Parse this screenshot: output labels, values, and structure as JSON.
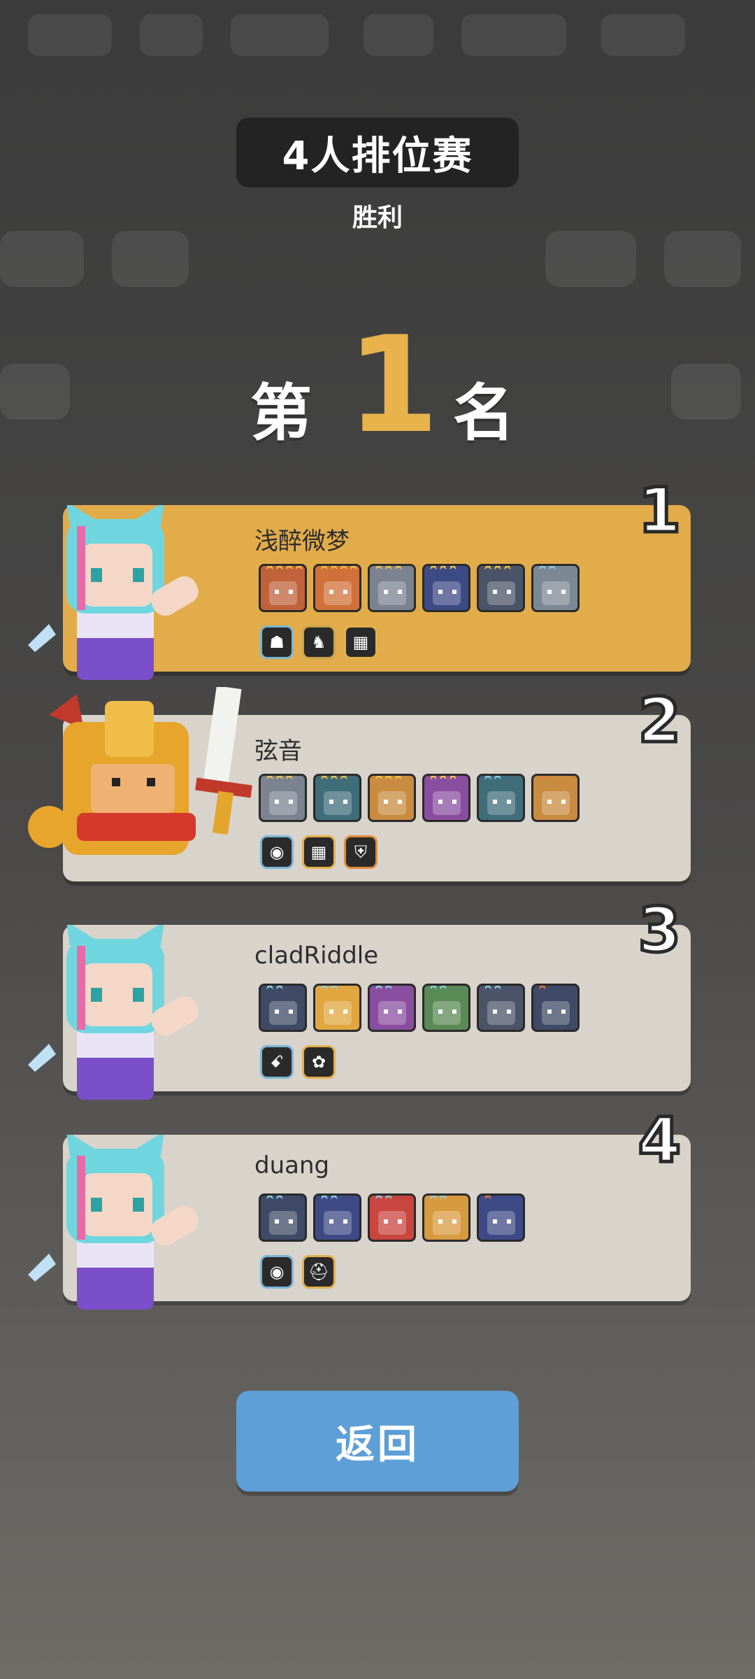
{
  "header": {
    "mode": "4人排位赛",
    "result": "胜利"
  },
  "rank": {
    "prefix": "第",
    "number": "1",
    "suffix": "名"
  },
  "players": [
    {
      "place": "1",
      "name": "浅醉微梦",
      "highlight": true,
      "avatar": "cat-girl-icon",
      "heroes": [
        {
          "color": "#c0623a",
          "stars": 4,
          "star_color": "#f3c64b"
        },
        {
          "color": "#d0703a",
          "stars": 4,
          "star_color": "#f3c64b"
        },
        {
          "color": "#7b8390",
          "stars": 3,
          "star_color": "#f3c64b"
        },
        {
          "color": "#3e4a86",
          "stars": 3,
          "star_color": "#f3c64b"
        },
        {
          "color": "#4b5368",
          "stars": 3,
          "star_color": "#f3c64b"
        },
        {
          "color": "#7d8895",
          "stars": 2,
          "star_color": "#8fd0e4"
        }
      ],
      "traits": [
        {
          "icon": "robot-icon",
          "border": "#7ab6d6"
        },
        {
          "icon": "knight-icon",
          "border": "#c9a24a"
        },
        {
          "icon": "blocks-icon",
          "border": "#e3b14a"
        }
      ]
    },
    {
      "place": "2",
      "name": "弦音",
      "highlight": false,
      "avatar": "gold-knight-icon",
      "heroes": [
        {
          "color": "#7b8390",
          "stars": 3,
          "star_color": "#f3c64b"
        },
        {
          "color": "#3f6d7a",
          "stars": 3,
          "star_color": "#f3c64b"
        },
        {
          "color": "#c98b3f",
          "stars": 3,
          "star_color": "#f3c64b"
        },
        {
          "color": "#8a4ea0",
          "stars": 3,
          "star_color": "#f3c64b"
        },
        {
          "color": "#3f6d7a",
          "stars": 2,
          "star_color": "#8fd0e4"
        },
        {
          "color": "#c98b3f",
          "stars": 1,
          "star_color": "#e07d3c"
        }
      ],
      "traits": [
        {
          "icon": "eye-icon",
          "border": "#7ab6d6"
        },
        {
          "icon": "blocks-icon",
          "border": "#e3b14a"
        },
        {
          "icon": "shield-icon",
          "border": "#e08a3a"
        }
      ]
    },
    {
      "place": "3",
      "name": "cladRiddle",
      "highlight": false,
      "avatar": "cat-girl-icon",
      "heroes": [
        {
          "color": "#3e4a66",
          "stars": 2,
          "star_color": "#8fd0e4"
        },
        {
          "color": "#e0a63f",
          "stars": 2,
          "star_color": "#8fd0e4"
        },
        {
          "color": "#8a4ea0",
          "stars": 2,
          "star_color": "#8fd0e4"
        },
        {
          "color": "#5a8a55",
          "stars": 2,
          "star_color": "#8fd0e4"
        },
        {
          "color": "#4b5368",
          "stars": 2,
          "star_color": "#8fd0e4"
        },
        {
          "color": "#3e4a66",
          "stars": 1,
          "star_color": "#e07d3c"
        }
      ],
      "traits": [
        {
          "icon": "serpent-icon",
          "border": "#7ab6d6"
        },
        {
          "icon": "frog-icon",
          "border": "#e3b14a"
        }
      ]
    },
    {
      "place": "4",
      "name": "duang",
      "highlight": false,
      "avatar": "cat-girl-icon",
      "heroes": [
        {
          "color": "#3e4a66",
          "stars": 2,
          "star_color": "#8fd0e4"
        },
        {
          "color": "#3e4a86",
          "stars": 2,
          "star_color": "#8fd0e4"
        },
        {
          "color": "#c9453f",
          "stars": 2,
          "star_color": "#8fd0e4"
        },
        {
          "color": "#d89a3f",
          "stars": 2,
          "star_color": "#8fd0e4"
        },
        {
          "color": "#3e4a86",
          "stars": 1,
          "star_color": "#e07d3c"
        }
      ],
      "traits": [
        {
          "icon": "eye-icon",
          "border": "#7ab6d6"
        },
        {
          "icon": "helmet-icon",
          "border": "#e3b14a"
        }
      ]
    }
  ],
  "footer": {
    "back_label": "返回"
  }
}
